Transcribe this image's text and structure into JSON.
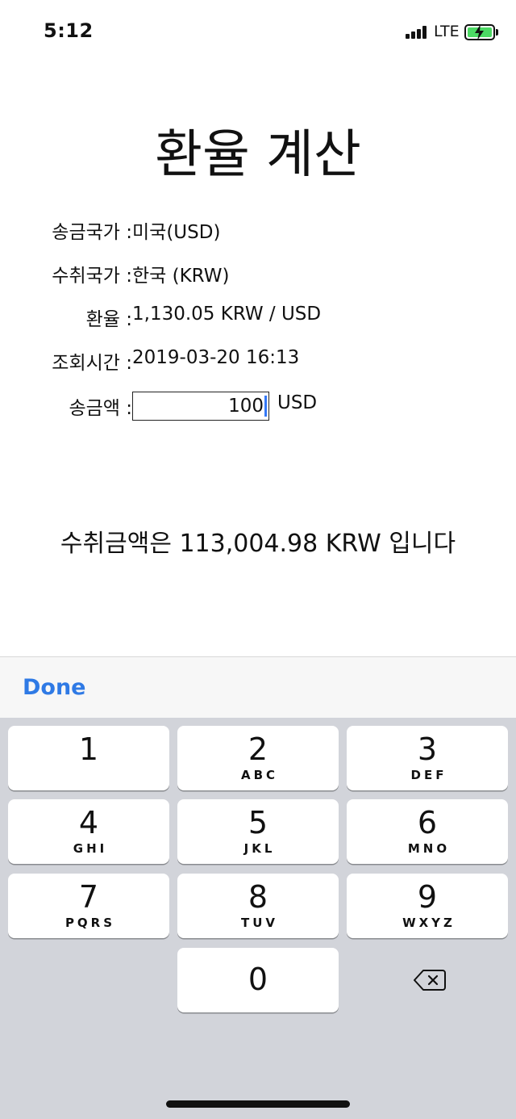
{
  "status_bar": {
    "time": "5:12",
    "network": "LTE",
    "battery_color": "#4cd964"
  },
  "title": "환율 계산",
  "info": {
    "send_country_label": "송금국가 :",
    "send_country_value": "미국(USD)",
    "receive_country_label": "수취국가 :",
    "receive_country_value": "한국 (KRW)",
    "rate_label": "환율 :",
    "rate_value": "1,130.05 KRW / USD",
    "time_label": "조회시간 :",
    "time_value": "2019-03-20 16:13",
    "amount_label": "송금액 :",
    "amount_value": "100",
    "amount_unit": "USD"
  },
  "result": "수취금액은 113,004.98 KRW 입니다",
  "keyboard": {
    "done_label": "Done",
    "accent_color": "#2f7ae5",
    "keys": [
      {
        "digit": "1",
        "letters": ""
      },
      {
        "digit": "2",
        "letters": "ABC"
      },
      {
        "digit": "3",
        "letters": "DEF"
      },
      {
        "digit": "4",
        "letters": "GHI"
      },
      {
        "digit": "5",
        "letters": "JKL"
      },
      {
        "digit": "6",
        "letters": "MNO"
      },
      {
        "digit": "7",
        "letters": "PQRS"
      },
      {
        "digit": "8",
        "letters": "TUV"
      },
      {
        "digit": "9",
        "letters": "WXYZ"
      },
      {
        "digit": "0",
        "letters": ""
      }
    ],
    "delete_icon": "backspace-icon"
  }
}
